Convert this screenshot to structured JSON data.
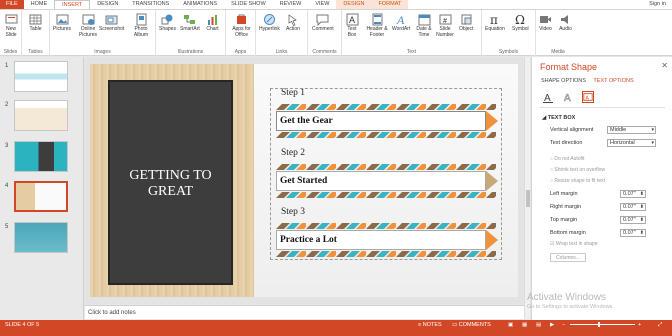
{
  "tabs": [
    "FILE",
    "HOME",
    "INSERT",
    "DESIGN",
    "TRANSITIONS",
    "ANIMATIONS",
    "SLIDE SHOW",
    "REVIEW",
    "VIEW",
    "DESIGN",
    "FORMAT"
  ],
  "sign_in": "Sign in",
  "ribbon": {
    "slides": {
      "label": "Slides",
      "new_slide": "New Slide"
    },
    "tables": {
      "label": "Tables",
      "table": "Table"
    },
    "images": {
      "label": "Images",
      "pictures": "Pictures",
      "online_pictures": "Online Pictures",
      "screenshot": "Screenshot",
      "photo_album": "Photo Album"
    },
    "illustrations": {
      "label": "Illustrations",
      "shapes": "Shapes",
      "smartart": "SmartArt",
      "chart": "Chart"
    },
    "apps": {
      "label": "Apps",
      "apps_for_office": "Apps for Office"
    },
    "links": {
      "label": "Links",
      "hyperlink": "Hyperlink",
      "action": "Action"
    },
    "comments": {
      "label": "Comments",
      "comment": "Comment"
    },
    "text": {
      "label": "Text",
      "text_box": "Text Box",
      "header_footer": "Header & Footer",
      "wordart": "WordArt",
      "date_time": "Date & Time",
      "slide_number": "Slide Number",
      "object": "Object"
    },
    "symbols": {
      "label": "Symbols",
      "equation": "Equation",
      "symbol": "Symbol"
    },
    "media": {
      "label": "Media",
      "video": "Video",
      "audio": "Audio"
    }
  },
  "thumbnails": [
    {
      "num": "1"
    },
    {
      "num": "2"
    },
    {
      "num": "3"
    },
    {
      "num": "4"
    },
    {
      "num": "5"
    }
  ],
  "slide": {
    "title": "GETTING TO GREAT",
    "steps": [
      {
        "label": "Step 1",
        "text": "Get the Gear"
      },
      {
        "label": "Step 2",
        "text": "Get Started"
      },
      {
        "label": "Step 3",
        "text": "Practice a Lot"
      }
    ]
  },
  "notes_placeholder": "Click to add notes",
  "format_pane": {
    "title": "Format Shape",
    "tabs": [
      "SHAPE OPTIONS",
      "TEXT OPTIONS"
    ],
    "section": "TEXT BOX",
    "vertical_alignment_label": "Vertical alignment",
    "vertical_alignment_value": "Middle",
    "text_direction_label": "Text direction",
    "text_direction_value": "Horizontal",
    "do_not_autofit": "Do not Autofit",
    "shrink_text": "Shrink text on overflow",
    "resize_shape": "Resize shape to fit text",
    "left_margin_label": "Left margin",
    "left_margin_value": "0.07\"",
    "right_margin_label": "Right margin",
    "right_margin_value": "0.07\"",
    "top_margin_label": "Top margin",
    "top_margin_value": "0.07\"",
    "bottom_margin_label": "Bottom margin",
    "bottom_margin_value": "0.07\"",
    "wrap_text": "Wrap text in shape",
    "columns_button": "Columns..."
  },
  "watermark": {
    "title": "Activate Windows",
    "sub": "Go to Settings to activate Windows."
  },
  "status": {
    "slide_info": "SLIDE 4 OF 5",
    "notes": "NOTES",
    "comments": "COMMENTS"
  },
  "colors": {
    "accent": "#D24726",
    "arrow_orange": "#F0913C",
    "arrow_teal": "#3BB3C3",
    "zig_brown": "#8B6B4A"
  }
}
